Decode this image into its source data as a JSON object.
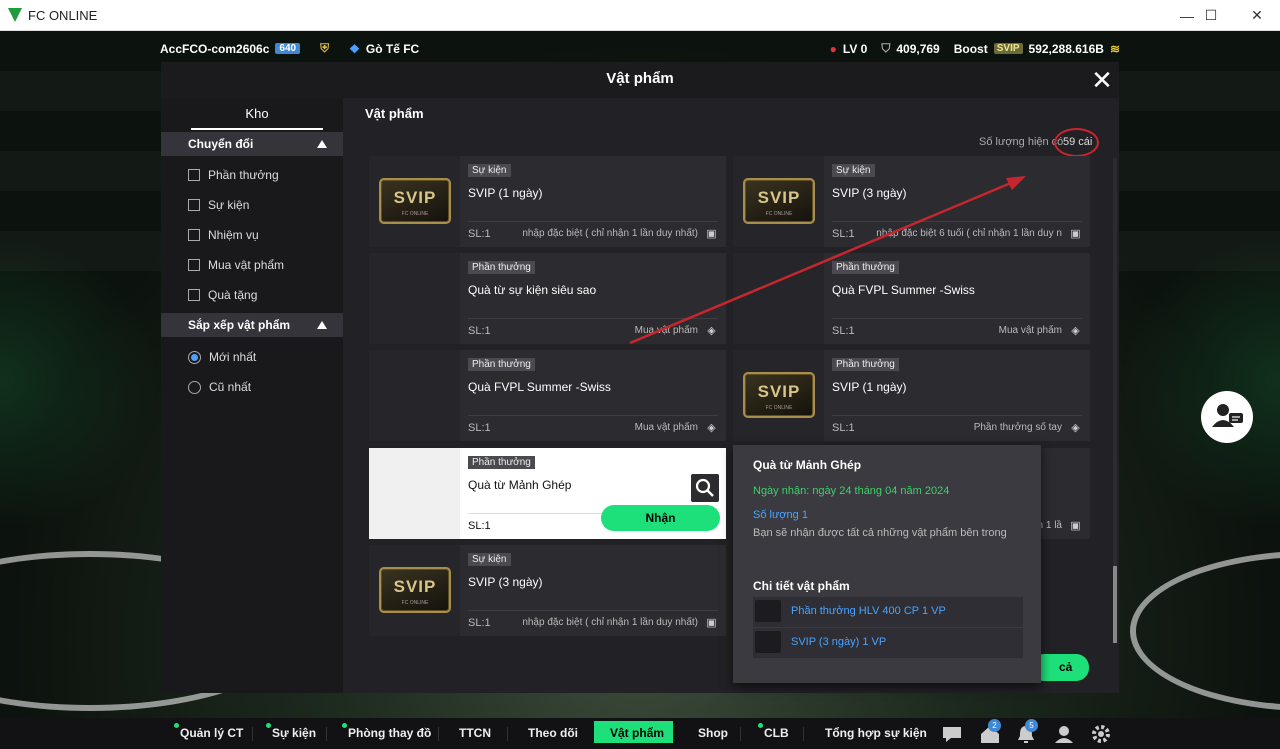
{
  "window": {
    "title": "FC ONLINE",
    "minimize": "—",
    "maximize": "☐",
    "close": "✕"
  },
  "hud": {
    "account": "AccFCO-com2606c",
    "level_badge": "640",
    "club": "Gò Tế FC",
    "lv": "LV 0",
    "coins": "409,769",
    "boost": "Boost",
    "svip": "SVIP",
    "bp": "592,288.616B"
  },
  "modal": {
    "title": "Vật phẩm",
    "close": "✕"
  },
  "sidebar": {
    "tab": "Kho",
    "section1": "Chuyển đổi",
    "filters": [
      "Phần thưởng",
      "Sự kiện",
      "Nhiệm vụ",
      "Mua vật phẩm",
      "Quà tặng"
    ],
    "section2": "Sắp xếp vật phẩm",
    "sorts": [
      "Mới nhất",
      "Cũ nhất"
    ]
  },
  "content": {
    "title": "Vật phẩm",
    "count_label": "Số lượng hiện có",
    "count_value": "59 cái"
  },
  "cards": [
    {
      "tag": "Sự kiện",
      "name": "SVIP (1 ngày)",
      "sl": "SL:1",
      "src": "nhập đặc biệt ( chỉ nhận 1 lần duy nhất)"
    },
    {
      "tag": "Sự kiện",
      "name": "SVIP (3 ngày)",
      "sl": "SL:1",
      "src": "nhập đặc biệt 6 tuổi ( chỉ nhận 1 lần duy n"
    },
    {
      "tag": "Phần thưởng",
      "name": "Quà từ sự kiện siêu sao",
      "sl": "SL:1",
      "src": "Mua vật phẩm"
    },
    {
      "tag": "Phần thưởng",
      "name": "Quà FVPL Summer -Swiss",
      "sl": "SL:1",
      "src": "Mua vật phẩm"
    },
    {
      "tag": "Phần thưởng",
      "name": "Quà FVPL Summer -Swiss",
      "sl": "SL:1",
      "src": "Mua vật phẩm"
    },
    {
      "tag": "Phần thưởng",
      "name": "SVIP (1 ngày)",
      "sl": "SL:1",
      "src": "Phần thưởng sổ tay"
    },
    {
      "tag": "Phần thưởng",
      "name": "Quà từ Mảnh Ghép",
      "sl": "SL:1",
      "src": ""
    },
    {
      "tag": "Sự kiện",
      "name": "SVIP (3 ngày)",
      "sl": "SL:1",
      "src": "nhập đặc biệt ( chỉ nhận 1 lần duy nhất)"
    }
  ],
  "partial_card_src": "n 1 lầ",
  "svip_logo": {
    "text": "SVIP",
    "sub": "FC ONLINE"
  },
  "receive_button": "Nhận",
  "bottom_button": "cả",
  "tooltip": {
    "title": "Quà từ Mảnh Ghép",
    "date": "Ngày nhận: ngày 24 tháng 04 năm 2024",
    "qty": "Số lượng 1",
    "desc": "Bạn sẽ nhận được tất cả những vật phẩm bên trong",
    "detail_title": "Chi tiết vật phẩm",
    "items": [
      "Phần thưởng HLV 400 CP 1 VP",
      "SVIP (3 ngày) 1 VP"
    ]
  },
  "bottomnav": {
    "items": [
      "Quản lý CT",
      "Sự kiện",
      "Phòng thay đồ",
      "TTCN",
      "Theo dõi",
      "Vật phẩm",
      "Shop",
      "CLB",
      "Tổng hợp sự kiện"
    ],
    "house_badge": "2",
    "bell_badge": "5"
  },
  "colors": {
    "accent": "#1ee07a",
    "blue": "#4aa3ff",
    "annotation": "#c8262e"
  }
}
